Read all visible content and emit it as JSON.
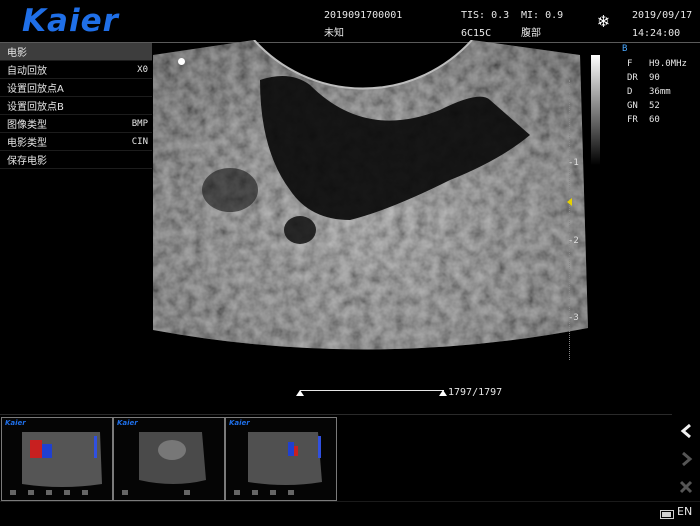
{
  "header": {
    "brand": "Kaier",
    "patient_id": "2019091700001",
    "patient_name": "未知",
    "tis": "TIS: 0.3",
    "mi": "MI: 0.9",
    "probe": "6C15C",
    "exam": "腹部",
    "date": "2019/09/17",
    "time": "14:24:00",
    "freeze_icon": "snowflake-icon"
  },
  "menu": {
    "title": "电影",
    "items": [
      {
        "label": "自动回放",
        "value": "X0"
      },
      {
        "label": "设置回放点A",
        "value": ""
      },
      {
        "label": "设置回放点B",
        "value": ""
      },
      {
        "label": "图像类型",
        "value": "BMP"
      },
      {
        "label": "电影类型",
        "value": "CIN"
      },
      {
        "label": "保存电影",
        "value": ""
      }
    ]
  },
  "params": {
    "mode": "B",
    "rows": [
      {
        "k": "F",
        "v": "H9.0MHz"
      },
      {
        "k": "DR",
        "v": "90"
      },
      {
        "k": "D",
        "v": "36mm"
      },
      {
        "k": "GN",
        "v": "52"
      },
      {
        "k": "FR",
        "v": "60"
      }
    ]
  },
  "depth_scale": [
    "-1",
    "-2",
    "-3"
  ],
  "cine": {
    "counter": "1797/1797"
  },
  "controls": {
    "prev": "chevron-left-icon",
    "next": "chevron-right-icon",
    "close": "close-icon"
  },
  "status": {
    "lang": "EN",
    "battery": "battery-icon"
  },
  "thumbnails": [
    {
      "brand": "Kaier"
    },
    {
      "brand": "Kaier"
    },
    {
      "brand": "Kaier"
    }
  ]
}
